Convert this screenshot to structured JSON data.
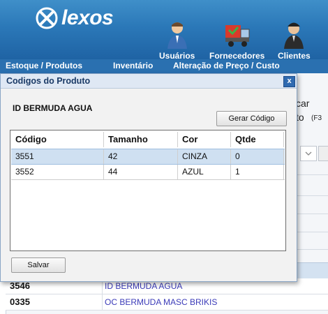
{
  "app": {
    "brand": "lexos",
    "toolbar": [
      {
        "label": "Usuários",
        "icon": "user-icon"
      },
      {
        "label": "Fornecedores",
        "icon": "truck-icon"
      },
      {
        "label": "Clientes",
        "icon": "client-icon"
      }
    ],
    "menu": [
      "Estoque / Produtos",
      "Inventário",
      "Alteração de Preço / Custo"
    ],
    "background": {
      "label_1": "car",
      "label_2": "to",
      "shortcut": "(F3",
      "rows": [
        {
          "code": "3546",
          "description": "ID BERMUDA AGUA"
        },
        {
          "code": "0335",
          "description": "OC BERMUDA MASC BRIKIS"
        }
      ]
    }
  },
  "dialog": {
    "title": "Codigos do Produto",
    "close": "x",
    "product_name": "ID BERMUDA AGUA",
    "generate_button": "Gerar Código",
    "save_button": "Salvar",
    "grid": {
      "columns": [
        "Código",
        "Tamanho",
        "Cor",
        "Qtde"
      ],
      "rows": [
        [
          "3551",
          "42",
          "CINZA",
          "0"
        ],
        [
          "3552",
          "44",
          "AZUL",
          "1"
        ]
      ],
      "selected_row": 0
    }
  },
  "colors": {
    "header": "#2b78b8",
    "menubar": "#2a70b0",
    "selected_row": "#cfe0f1",
    "link_text": "#3b3bb8"
  }
}
